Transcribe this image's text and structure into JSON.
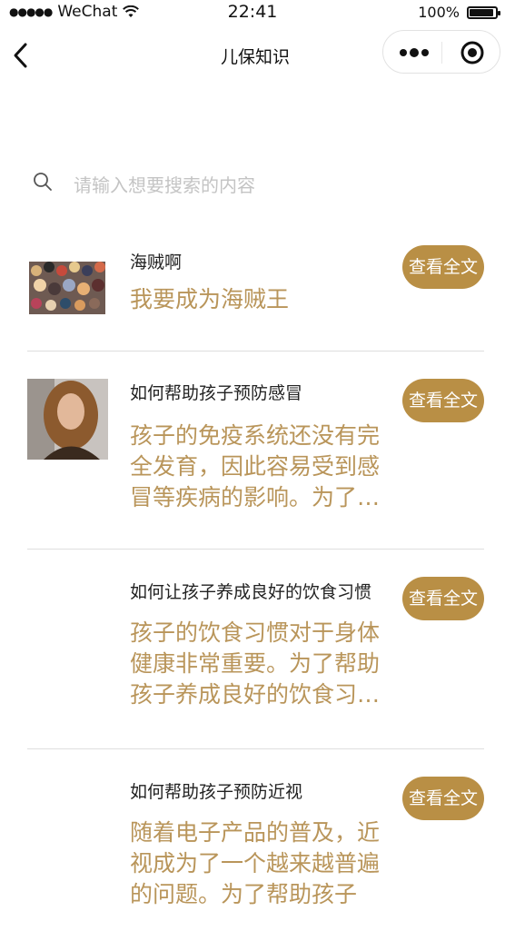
{
  "status_bar": {
    "carrier": "WeChat",
    "time": "22:41",
    "battery_percent": "100%",
    "battery_level": 1.0
  },
  "nav": {
    "title": "儿保知识",
    "back_icon": "chevron-left-icon",
    "more_icon": "more-dots-icon",
    "close_icon": "target-icon"
  },
  "search": {
    "placeholder": "请输入想要搜索的内容",
    "icon": "search-icon"
  },
  "articles": [
    {
      "title": "海贼啊",
      "desc": "我要成为海贼王",
      "button": "查看全文",
      "thumb": "crowd-collage"
    },
    {
      "title": "如何帮助孩子预防感冒",
      "desc": "孩子的免疫系统还没有完全发育，因此容易受到感冒等疾病的影响。为了帮助孩子预防感冒，家长需要注意以下几点。",
      "button": "查看全文",
      "thumb": "portrait-photo"
    },
    {
      "title": "如何让孩子养成良好的饮食习惯",
      "desc": "孩子的饮食习惯对于身体健康非常重要。为了帮助孩子养成良好的饮食习惯，家长需要注意以下几点。",
      "button": "查看全文",
      "thumb": ""
    },
    {
      "title": "如何帮助孩子预防近视",
      "desc": "随着电子产品的普及，近视成为了一个越来越普遍的问题。为了帮助孩子",
      "button": "查看全文",
      "thumb": ""
    }
  ],
  "colors": {
    "accent": "#b98f45",
    "desc_text": "#b9955a",
    "divider": "#dedede"
  }
}
